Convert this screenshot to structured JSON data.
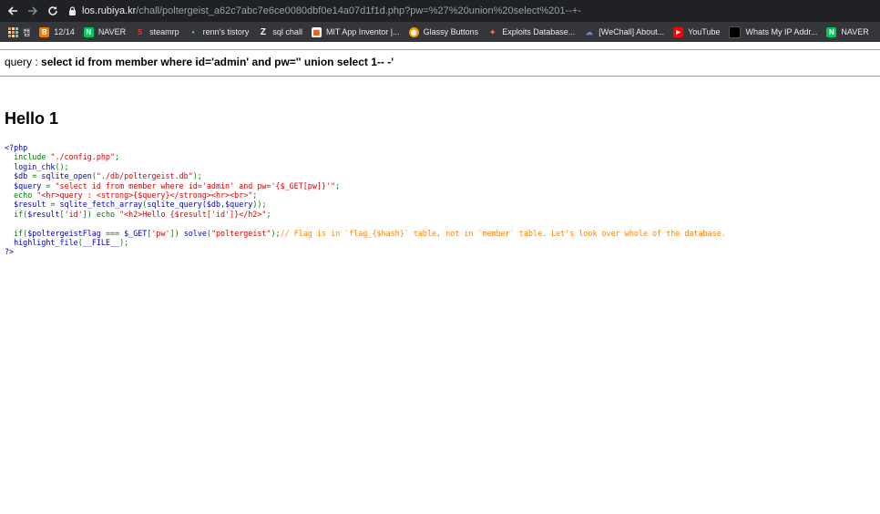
{
  "browser": {
    "url_host": "los.rubiya.kr",
    "url_path": "/chall/poltergeist_a62c7abc7e6ce0080dbf0e14a07d1f1d.php?pw=%27%20union%20select%201--+-"
  },
  "bookmarks": [
    {
      "label": "",
      "icon": "apps-icon"
    },
    {
      "label": "캡",
      "icon": "bookmark-icon"
    },
    {
      "label": "12/14",
      "icon": "blogger-icon",
      "color": "#f57c00",
      "glyph": "B"
    },
    {
      "label": "NAVER",
      "icon": "naver-icon",
      "color": "#03c75a",
      "glyph": "N"
    },
    {
      "label": "steamrp",
      "icon": "steamrp-icon",
      "color": "#c62828",
      "glyph": "S"
    },
    {
      "label": "renn's tistory",
      "icon": "tistory-icon",
      "color": "#35363a",
      "glyph": "•"
    },
    {
      "label": "sql chall",
      "icon": "z-icon",
      "color": "#ffffff",
      "glyph": "Z"
    },
    {
      "label": "MIT App Inventor |...",
      "icon": "app-inventor-icon",
      "color": "#ffc107",
      "glyph": "▦"
    },
    {
      "label": "Glassy Buttons",
      "icon": "glassy-icon",
      "color": "#ff9800",
      "glyph": "◉"
    },
    {
      "label": "Exploits Database...",
      "icon": "exploitdb-icon",
      "color": "#e57373",
      "glyph": "✦"
    },
    {
      "label": "[WeChall] About...",
      "icon": "wechall-icon",
      "color": "#3f51b5",
      "glyph": "☁"
    },
    {
      "label": "YouTube",
      "icon": "youtube-icon",
      "color": "#ff0000",
      "glyph": "▶"
    },
    {
      "label": "Whats My IP Addr...",
      "icon": "ip-icon",
      "color": "#111111",
      "glyph": "⬛"
    },
    {
      "label": "NAVER",
      "icon": "naver-icon",
      "color": "#03c75a",
      "glyph": "N"
    }
  ],
  "page": {
    "query_label": "query : ",
    "query_value": "select id from member where id='admin' and pw='' union select 1-- -'",
    "hello": "Hello 1"
  },
  "source": {
    "l01": "<?php",
    "l02a": "  include ",
    "l02b": "\"./config.php\"",
    "l02c": ";",
    "l03a": "  login_chk",
    "l03b": "();",
    "l04a": "  $db ",
    "l04b": "= ",
    "l04c": "sqlite_open",
    "l04d": "(",
    "l04e": "\"./db/poltergeist.db\"",
    "l04f": ");",
    "l05a": "  $query ",
    "l05b": "= ",
    "l05c": "\"select id from member where id='admin' and pw='{$_GET[pw]}'\"",
    "l05d": ";",
    "l06a": "  echo ",
    "l06b": "\"<hr>query : <strong>{$query}</strong><hr><br>\"",
    "l06c": ";",
    "l07a": "  $result ",
    "l07b": "= ",
    "l07c": "sqlite_fetch_array",
    "l07d": "(",
    "l07e": "sqlite_query",
    "l07f": "($db",
    "l07g": ",",
    "l07h": "$query",
    "l07i": "));",
    "l08a": "  if(",
    "l08b": "$result",
    "l08c": "[",
    "l08d": "'id'",
    "l08e": "]) echo ",
    "l08f": "\"<h2>Hello {$result['id']}</h2>\"",
    "l08g": ";",
    "l10a": "  if(",
    "l10b": "$poltergeistFlag ",
    "l10c": "=== ",
    "l10d": "$_GET",
    "l10e": "[",
    "l10f": "'pw'",
    "l10g": "]) ",
    "l10h": "solve",
    "l10i": "(",
    "l10j": "\"poltergeist\"",
    "l10k": ");",
    "l10l": "// Flag is in `flag_{$hash}` table, not in `member` table. Let's look over whole of the database.",
    "l11a": "  highlight_file",
    "l11b": "(",
    "l11c": "__FILE__",
    "l11d": ");",
    "l12": "?>"
  }
}
